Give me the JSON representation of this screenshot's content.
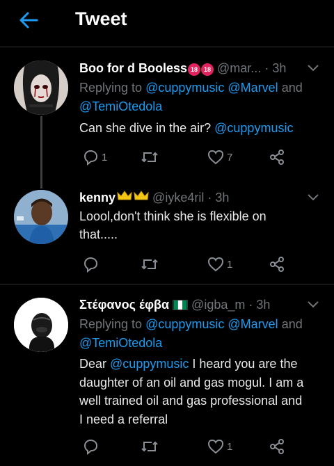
{
  "header": {
    "title": "Tweet"
  },
  "tweets": [
    {
      "name": "Boo for d Booless",
      "badges": [
        "18",
        "18"
      ],
      "handle": "@mar...",
      "time": "· 3h",
      "replying_prefix": "Replying to",
      "mentions_line1": "@cuppymusic @Marvel",
      "and": "and",
      "mentions_line2": "@TemiOtedola",
      "text": "Can she dive in the air?",
      "text_mention": "@cuppymusic",
      "replies": "1",
      "retweets": "",
      "likes": "7"
    },
    {
      "name": "kenny",
      "handle": "@iyke4ril",
      "time": "· 3h",
      "text_line1": "Loool,don't think she is flexible on",
      "text_line2": "that.....",
      "replies": "",
      "retweets": "",
      "likes": "1"
    },
    {
      "name": "Στέφανος έφβα",
      "handle": "@igba_m",
      "time": "· 3h",
      "replying_prefix": "Replying to",
      "mentions_line1": "@cuppymusic @Marvel",
      "and": "and",
      "mentions_line2": "@TemiOtedola",
      "text_prefix": "Dear",
      "text_mention": "@cuppymusic",
      "text_line1_rest": "I heard you are the",
      "text_line2": "daughter of an oil and gas mogul. I am a",
      "text_line3": "well trained oil and gas professional and",
      "text_line4": "I need a referral",
      "replies": "",
      "retweets": "",
      "likes": "1"
    }
  ],
  "colors": {
    "accent": "#1d9bf0",
    "background": "#000000",
    "muted": "#71767b"
  },
  "icons": [
    "back-arrow-icon",
    "chevron-down-icon",
    "reply-icon",
    "retweet-icon",
    "like-icon",
    "share-icon",
    "nigeria-flag-icon",
    "crown-icon"
  ]
}
